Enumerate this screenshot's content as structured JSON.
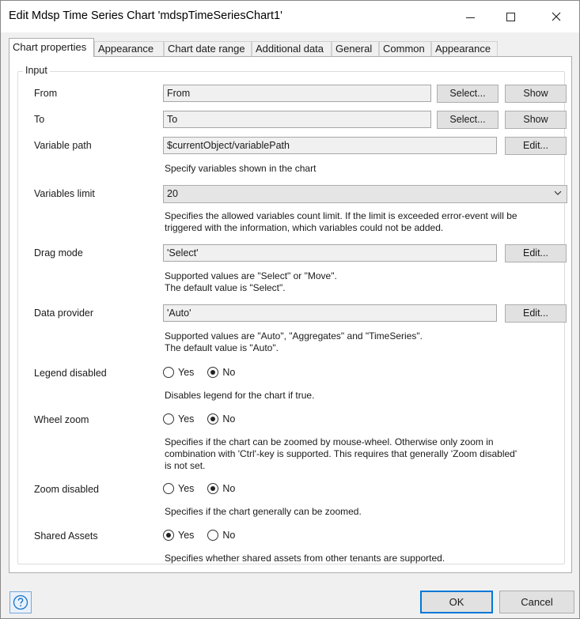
{
  "window": {
    "title": "Edit Mdsp Time Series Chart 'mdspTimeSeriesChart1'",
    "controls": {
      "minimize": "minimize",
      "maximize": "maximize",
      "close": "close"
    }
  },
  "tabs": [
    {
      "label": "Chart properties",
      "active": true
    },
    {
      "label": "Appearance"
    },
    {
      "label": "Chart date range"
    },
    {
      "label": "Additional data"
    },
    {
      "label": "General"
    },
    {
      "label": "Common"
    },
    {
      "label": "Appearance"
    }
  ],
  "group": {
    "title": "Input"
  },
  "rows": {
    "from": {
      "label": "From",
      "value": "From",
      "select_label": "Select...",
      "show_label": "Show"
    },
    "to": {
      "label": "To",
      "value": "To",
      "select_label": "Select...",
      "show_label": "Show"
    },
    "variable_path": {
      "label": "Variable path",
      "value": "$currentObject/variablePath",
      "edit_label": "Edit...",
      "desc": "Specify variables shown in the chart"
    },
    "variables_limit": {
      "label": "Variables limit",
      "value": "20",
      "desc_line1": "Specifies the allowed variables count limit. If the limit is exceeded error-event will be",
      "desc_line2": "triggered with the information, which variables could not be added."
    },
    "drag_mode": {
      "label": "Drag mode",
      "value": "'Select'",
      "edit_label": "Edit...",
      "desc_line1": "Supported values are \"Select\" or \"Move\".",
      "desc_line2": "The default value is \"Select\"."
    },
    "data_provider": {
      "label": "Data provider",
      "value": "'Auto'",
      "edit_label": "Edit...",
      "desc_line1": "Supported values are \"Auto\", \"Aggregates\" and \"TimeSeries\".",
      "desc_line2": "The default value is \"Auto\"."
    },
    "legend_disabled": {
      "label": "Legend disabled",
      "yes": "Yes",
      "no": "No",
      "selected": "No",
      "desc": "Disables legend for the chart if true."
    },
    "wheel_zoom": {
      "label": "Wheel zoom",
      "yes": "Yes",
      "no": "No",
      "selected": "No",
      "desc_line1": "Specifies if the chart can be zoomed by mouse-wheel. Otherwise only zoom in",
      "desc_line2": "combination with 'Ctrl'-key is supported. This requires that generally 'Zoom disabled'",
      "desc_line3": "is not set."
    },
    "zoom_disabled": {
      "label": "Zoom disabled",
      "yes": "Yes",
      "no": "No",
      "selected": "No",
      "desc": "Specifies if the chart generally can be zoomed."
    },
    "shared_assets": {
      "label": "Shared Assets",
      "yes": "Yes",
      "no": "No",
      "selected": "Yes",
      "desc": "Specifies whether shared assets from other tenants are supported."
    }
  },
  "footer": {
    "help_icon": "question-circle-icon",
    "ok_label": "OK",
    "cancel_label": "Cancel"
  },
  "colors": {
    "accent": "#0078d7",
    "help_icon": "#1a73c7"
  }
}
